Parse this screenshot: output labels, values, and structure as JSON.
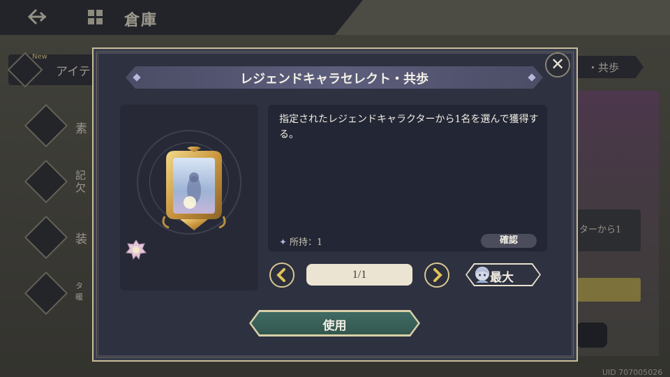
{
  "header": {
    "title": "倉庫"
  },
  "background": {
    "tab_left_label": "アイテ",
    "tab_left_badge": "New",
    "tab_right_label": "・共歩",
    "side_items": [
      {
        "label": "素"
      },
      {
        "label": "記\n欠"
      },
      {
        "label": "装"
      },
      {
        "label": "タ\n暖"
      }
    ],
    "card_text": "ターから1",
    "uid": "UID 707005026"
  },
  "modal": {
    "title": "レジェンドキャラセレクト・共歩",
    "description": "指定されたレジェンドキャラクターから1名を選んで獲得する。",
    "owned_label": "所持：1",
    "confirm_label": "確認",
    "quantity": "1/1",
    "max_label": "最大",
    "use_label": "使用",
    "close_symbol": "✕"
  },
  "icons": {
    "back": "back-arrow-icon",
    "grid": "grid-menu-icon",
    "close": "close-icon",
    "prev": "chevron-left-icon",
    "next": "chevron-right-icon",
    "item": "golden-frame-item-icon",
    "badge": "character-badge-icon",
    "max": "character-avatar-icon"
  },
  "colors": {
    "modal_bg": "#2d3140",
    "gold_accent": "#c9a24a",
    "use_button": "#3f6a63",
    "title_banner": "#5c5e7c"
  }
}
